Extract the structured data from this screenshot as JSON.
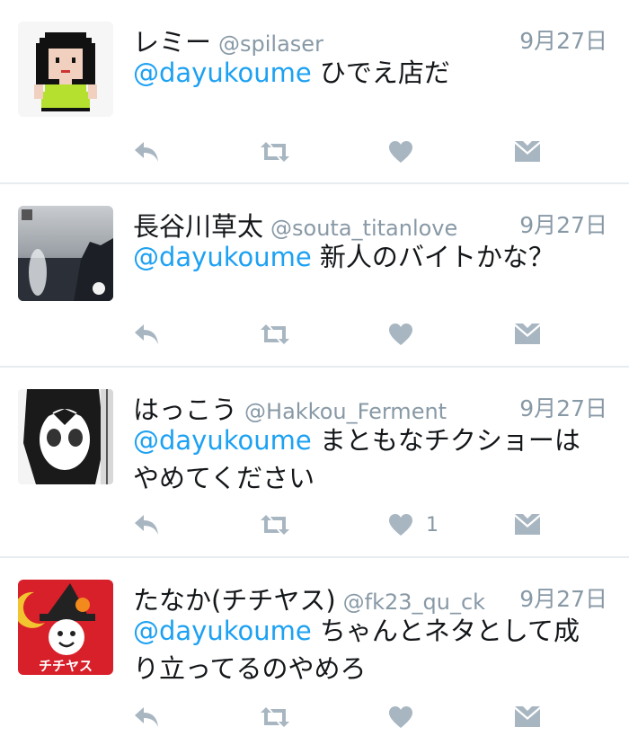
{
  "tweets": [
    {
      "name": "レミー",
      "handle": "@spilaser",
      "time": "9月27日",
      "mention": "@dayukoume",
      "text": " ひでえ店だ",
      "likes": ""
    },
    {
      "name": "長谷川草太",
      "handle": "@souta_titanlove",
      "time": "9月27日",
      "mention": "@dayukoume",
      "text": " 新人のバイトかな？",
      "likes": ""
    },
    {
      "name": "はっこう",
      "handle": "@Hakkou_Ferment",
      "time": "9月27日",
      "mention": "@dayukoume",
      "text": " まともなチクショーはやめてください",
      "likes": "1"
    },
    {
      "name": "たなか(チチヤス)",
      "handle": "@fk23_qu_ck",
      "time": "9月27日",
      "mention": "@dayukoume",
      "text": " ちゃんとネタとして成り立ってるのやめろ",
      "likes": "",
      "avatar_text": "チチヤス"
    }
  ],
  "colors": {
    "mention": "#1da1f2",
    "icon": "#a8b6c1",
    "divider": "#e6ecf0"
  },
  "icons": [
    "reply-icon",
    "retweet-icon",
    "like-icon",
    "dm-icon"
  ]
}
